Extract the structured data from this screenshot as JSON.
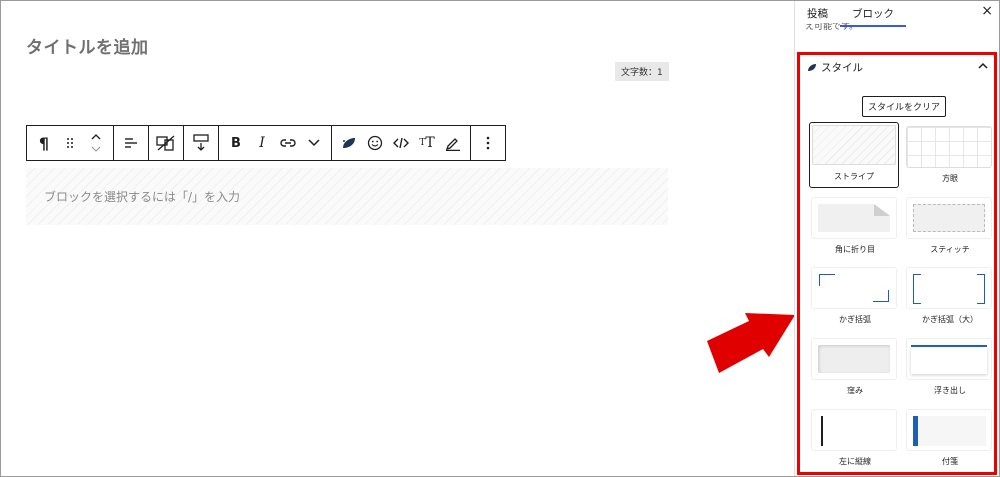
{
  "editor": {
    "title_placeholder": "タイトルを追加",
    "char_count": "文字数：1",
    "block_placeholder": "ブロックを選択するには「/」を入力"
  },
  "toolbar": {
    "paragraph_symbol": "¶"
  },
  "sidebar": {
    "tabs": [
      "投稿",
      "ブロック"
    ],
    "active_tab": "ブロック",
    "close_symbol": "×",
    "cut_text": "え可能です。",
    "panel_title": "スタイル",
    "clear_button": "スタイルをクリア",
    "styles": [
      {
        "label": "ストライプ",
        "selected": true
      },
      {
        "label": "方眼",
        "selected": false
      },
      {
        "label": "角に折り目",
        "selected": false
      },
      {
        "label": "スティッチ",
        "selected": false
      },
      {
        "label": "かぎ括弧",
        "selected": false
      },
      {
        "label": "かぎ括弧（大）",
        "selected": false
      },
      {
        "label": "窪み",
        "selected": false
      },
      {
        "label": "浮き出し",
        "selected": false
      },
      {
        "label": "左に縦線",
        "selected": false
      },
      {
        "label": "付箋",
        "selected": false
      }
    ]
  },
  "colors": {
    "highlight_red": "#ee0000",
    "accent_blue": "#3858e9",
    "frame_blue": "#1e5fb4"
  }
}
